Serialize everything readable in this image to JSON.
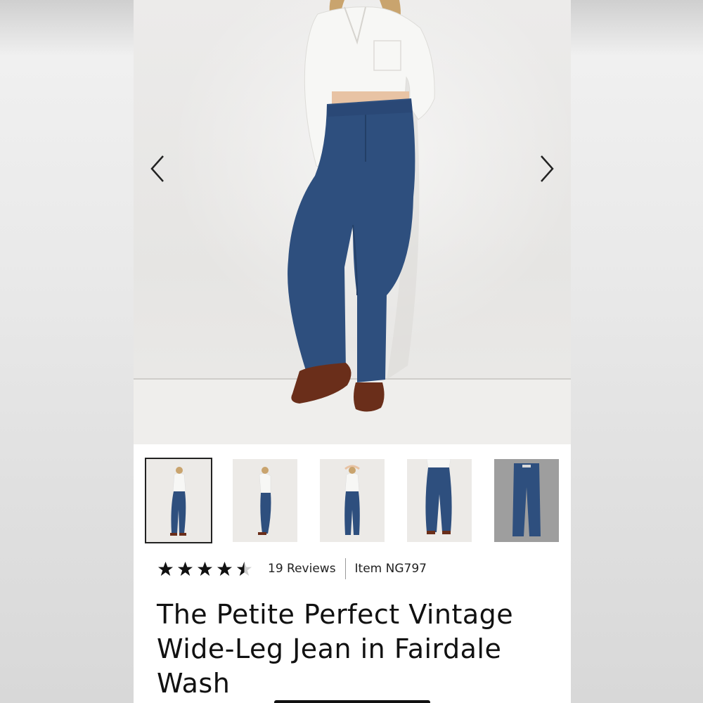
{
  "product": {
    "title": "The Petite Perfect Vintage Wide-Leg Jean in Fairdale Wash",
    "rating": 4.5,
    "rating_max": 5,
    "reviews_label": "19 Reviews",
    "item_label": "Item NG797"
  },
  "gallery": {
    "prev_icon": "chevron-left-icon",
    "next_icon": "chevron-right-icon",
    "thumbnail_count": 5,
    "selected_index": 0
  },
  "colors": {
    "denim": "#2e4f7e",
    "shirt": "#f7f7f5",
    "shoes": "#6a2e1a",
    "star": "#111111"
  }
}
